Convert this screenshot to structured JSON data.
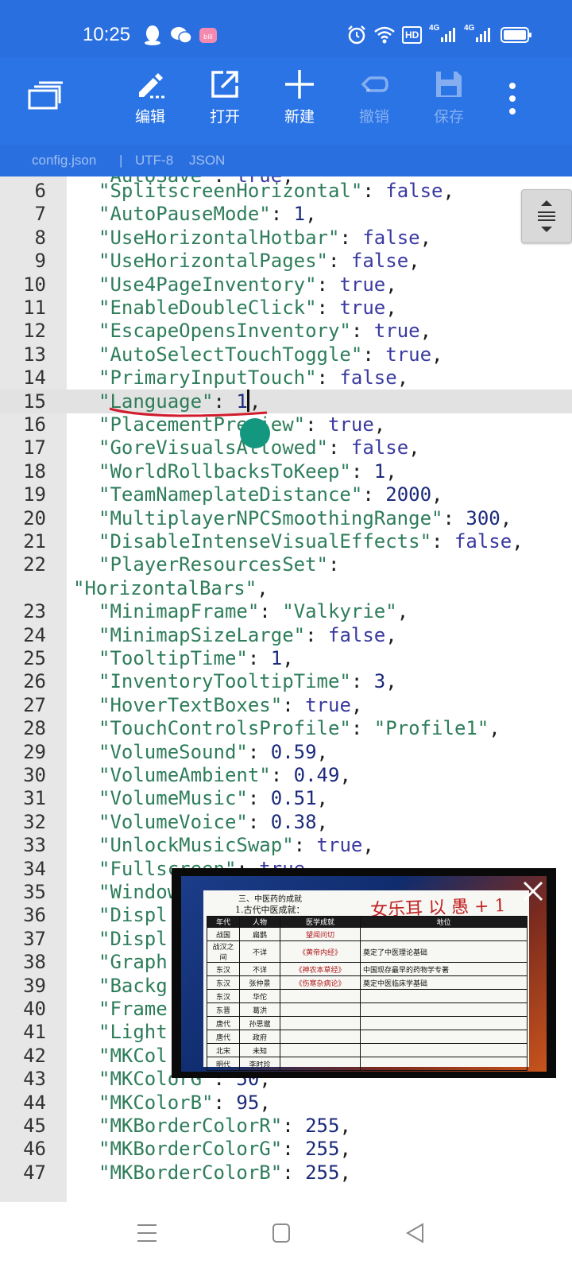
{
  "status": {
    "time": "10:25",
    "icons": [
      "qq-icon",
      "wechat-icon",
      "bilibili-icon",
      "alarm-icon",
      "wifi-icon",
      "hd-icon",
      "signal-4g-icon",
      "signal-4g-icon",
      "battery-icon"
    ],
    "hd_label": "HD",
    "net1": "4G",
    "net2": "4G"
  },
  "toolbar": {
    "edit": "编辑",
    "open": "打开",
    "new": "新建",
    "undo": "撤销",
    "save": "保存"
  },
  "fileinfo": {
    "name": "config.json",
    "sep": "|",
    "encoding": "UTF-8",
    "type": "JSON"
  },
  "editor": {
    "lines": [
      {
        "n": "6",
        "k": "\"SplitscreenHorizontal\"",
        "v": "false",
        "t": "bool"
      },
      {
        "n": "7",
        "k": "\"AutoPauseMode\"",
        "v": "1",
        "t": "num"
      },
      {
        "n": "8",
        "k": "\"UseHorizontalHotbar\"",
        "v": "false",
        "t": "bool"
      },
      {
        "n": "9",
        "k": "\"UseHorizontalPages\"",
        "v": "false",
        "t": "bool"
      },
      {
        "n": "10",
        "k": "\"Use4PageInventory\"",
        "v": "true",
        "t": "bool"
      },
      {
        "n": "11",
        "k": "\"EnableDoubleClick\"",
        "v": "true",
        "t": "bool"
      },
      {
        "n": "12",
        "k": "\"EscapeOpensInventory\"",
        "v": "true",
        "t": "bool"
      },
      {
        "n": "13",
        "k": "\"AutoSelectTouchToggle\"",
        "v": "true",
        "t": "bool"
      },
      {
        "n": "14",
        "k": "\"PrimaryInputTouch\"",
        "v": "false",
        "t": "bool"
      },
      {
        "n": "15",
        "k": "\"Language\"",
        "v": "1",
        "t": "num"
      },
      {
        "n": "16",
        "k": "\"PlacementPreview\"",
        "v": "true",
        "t": "bool"
      },
      {
        "n": "17",
        "k": "\"GoreVisualsAllowed\"",
        "v": "false",
        "t": "bool"
      },
      {
        "n": "18",
        "k": "\"WorldRollbacksToKeep\"",
        "v": "1",
        "t": "num"
      },
      {
        "n": "19",
        "k": "\"TeamNameplateDistance\"",
        "v": "2000",
        "t": "num"
      },
      {
        "n": "20",
        "k": "\"MultiplayerNPCSmoothingRange\"",
        "v": "300",
        "t": "num"
      },
      {
        "n": "21",
        "k": "\"DisableIntenseVisualEffects\"",
        "v": "false",
        "t": "bool"
      },
      {
        "n": "22",
        "k": "\"PlayerResourcesSet\"",
        "v": "",
        "t": "none"
      },
      {
        "n": "",
        "k": "",
        "v": "\"HorizontalBars\"",
        "t": "wrap"
      },
      {
        "n": "23",
        "k": "\"MinimapFrame\"",
        "v": "\"Valkyrie\"",
        "t": "str"
      },
      {
        "n": "24",
        "k": "\"MinimapSizeLarge\"",
        "v": "false",
        "t": "bool"
      },
      {
        "n": "25",
        "k": "\"TooltipTime\"",
        "v": "1",
        "t": "num"
      },
      {
        "n": "26",
        "k": "\"InventoryTooltipTime\"",
        "v": "3",
        "t": "num"
      },
      {
        "n": "27",
        "k": "\"HoverTextBoxes\"",
        "v": "true",
        "t": "bool"
      },
      {
        "n": "28",
        "k": "\"TouchControlsProfile\"",
        "v": "\"Profile1\"",
        "t": "str"
      },
      {
        "n": "29",
        "k": "\"VolumeSound\"",
        "v": "0.59",
        "t": "num"
      },
      {
        "n": "30",
        "k": "\"VolumeAmbient\"",
        "v": "0.49",
        "t": "num"
      },
      {
        "n": "31",
        "k": "\"VolumeMusic\"",
        "v": "0.51",
        "t": "num"
      },
      {
        "n": "32",
        "k": "\"VolumeVoice\"",
        "v": "0.38",
        "t": "num"
      },
      {
        "n": "33",
        "k": "\"UnlockMusicSwap\"",
        "v": "true",
        "t": "bool"
      },
      {
        "n": "34",
        "k": "\"Fullscreen\"",
        "v": "true",
        "t": "bool"
      },
      {
        "n": "35",
        "k": "\"Window",
        "v": "",
        "t": "cut"
      },
      {
        "n": "36",
        "k": "\"Displ",
        "v": "",
        "t": "cut"
      },
      {
        "n": "37",
        "k": "\"Displ",
        "v": "",
        "t": "cut"
      },
      {
        "n": "38",
        "k": "\"Graph",
        "v": "",
        "t": "cut"
      },
      {
        "n": "39",
        "k": "\"Backg",
        "v": "",
        "t": "cut"
      },
      {
        "n": "40",
        "k": "\"Frame",
        "v": "",
        "t": "cut"
      },
      {
        "n": "41",
        "k": "\"Light",
        "v": "",
        "t": "cut"
      },
      {
        "n": "42",
        "k": "\"MKCol",
        "v": "",
        "t": "cut"
      },
      {
        "n": "43",
        "k": "\"MKColorG\"",
        "v": "50",
        "t": "num"
      },
      {
        "n": "44",
        "k": "\"MKColorB\"",
        "v": "95",
        "t": "num"
      },
      {
        "n": "45",
        "k": "\"MKBorderColorR\"",
        "v": "255",
        "t": "num"
      },
      {
        "n": "46",
        "k": "\"MKBorderColorG\"",
        "v": "255",
        "t": "num"
      },
      {
        "n": "47",
        "k": "\"MKBorderColorB\"",
        "v": "255",
        "t": "num"
      }
    ],
    "current_line": "15"
  },
  "video": {
    "heading": "三、中医药的成就",
    "subheading": "1.古代中医成就：",
    "handwriting": "女乐耳 以 愚 + 1",
    "columns": [
      "年代",
      "人物",
      "医学成就",
      "地位"
    ],
    "rows": [
      [
        "战国",
        "扁鹊",
        "望闻问切",
        ""
      ],
      [
        "战汉之间",
        "不详",
        "《黄帝内经》",
        "奠定了中医理论基础"
      ],
      [
        "东汉",
        "不详",
        "《神农本草经》",
        "中国现存最早的药物学专著"
      ],
      [
        "东汉",
        "张仲景",
        "《伤寒杂病论》",
        "奠定中医临床学基础"
      ],
      [
        "东汉",
        "华佗",
        "",
        ""
      ],
      [
        "东晋",
        "葛洪",
        "",
        ""
      ],
      [
        "唐代",
        "孙思邈",
        "",
        ""
      ],
      [
        "唐代",
        "政府",
        "",
        ""
      ],
      [
        "北宋",
        "未知",
        "",
        ""
      ],
      [
        "明代",
        "李时珍",
        "",
        ""
      ]
    ]
  },
  "colors": {
    "toolbar": "#2b74e6",
    "key": "#2e7d5b",
    "literal": "#3a3aa0",
    "annotation": "#d01c2c",
    "touch_dot": "#13977e"
  },
  "nav": {
    "icons": [
      "menu-icon",
      "home-icon",
      "back-icon"
    ]
  }
}
